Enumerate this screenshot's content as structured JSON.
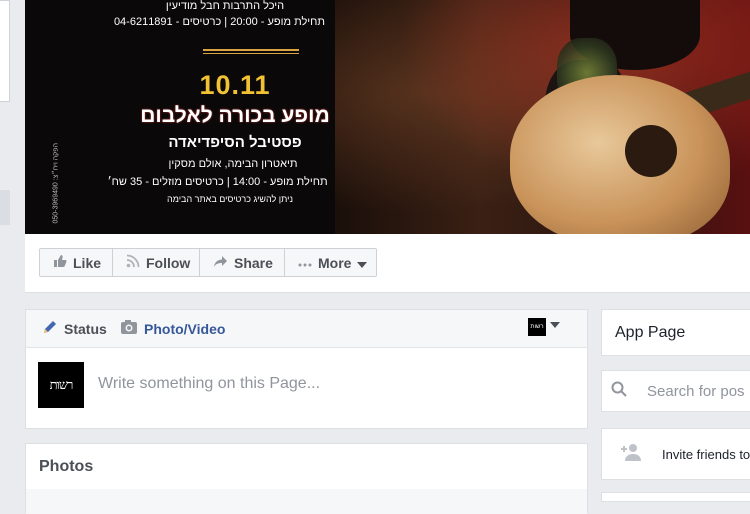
{
  "cover": {
    "venue_line": "היכל התרבות חבל מודיעין",
    "show_line_1": "תחילת מופע - 20:00 | כרטיסים - 04-6211891",
    "date": "10.11",
    "title": "מופע בכורה לאלבום",
    "subtitle": "פסטיבל הסיפדיאדה",
    "venue_line_2": "תיאטרון הבימה, אולם מסקין",
    "show_line_2": "תחילת מופע - 14:00 | כרטיסים מוזלים - 35 שח׳",
    "tickets_note": "ניתן להשיג כרטיסים באתר הבימה",
    "vertical_text": "050-3969490 :הפקה ויח״צ"
  },
  "actions": {
    "like": "Like",
    "follow": "Follow",
    "share": "Share",
    "more": "More"
  },
  "composer": {
    "tab_status": "Status",
    "tab_photo": "Photo/Video",
    "avatar_text": "רשות",
    "placeholder": "Write something on this Page..."
  },
  "photos": {
    "title": "Photos"
  },
  "sidebar": {
    "app_page": "App Page",
    "search_placeholder": "Search for pos",
    "invite": "Invite friends to"
  },
  "icons": {
    "like": "thumbs-up-icon",
    "follow": "rss-icon",
    "share": "share-arrow-icon",
    "more": "ellipsis-icon",
    "status": "pencil-icon",
    "photo": "camera-icon",
    "search": "search-icon",
    "invite": "add-person-icon"
  },
  "colors": {
    "page_bg": "#e9ebee",
    "link_blue": "#365899",
    "date_gold": "#f2c233"
  }
}
